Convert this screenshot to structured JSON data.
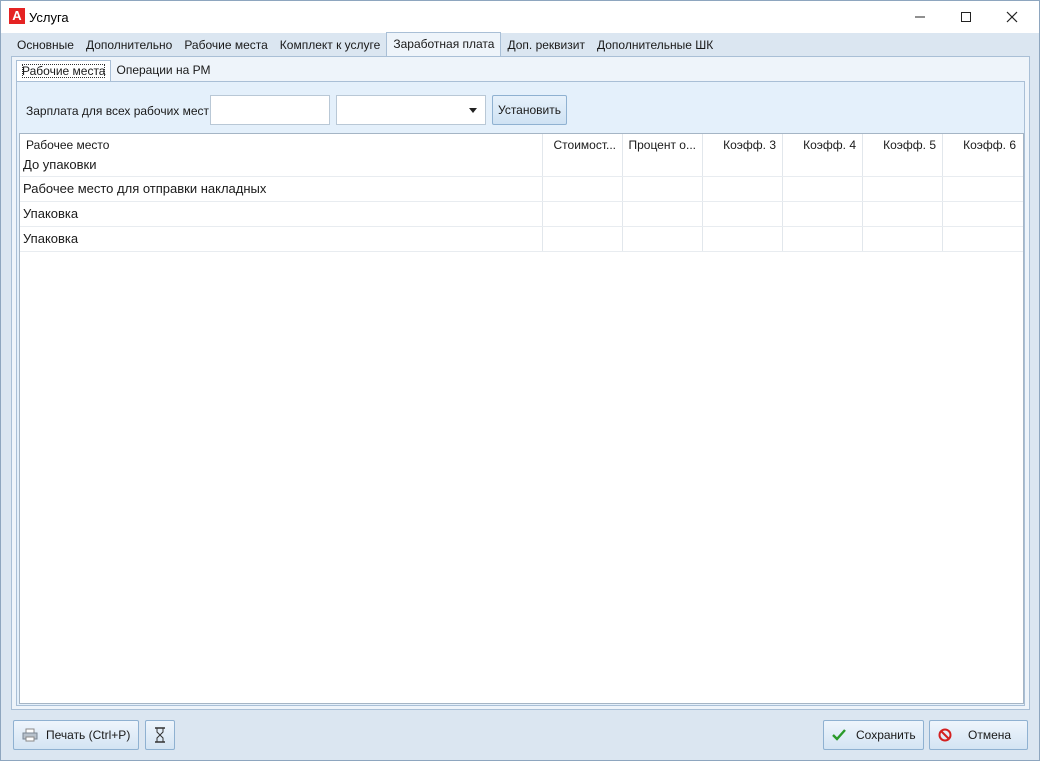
{
  "window": {
    "title": "Услуга",
    "app_icon_letter": "A"
  },
  "tabs": [
    {
      "label": "Основные"
    },
    {
      "label": "Дополнительно"
    },
    {
      "label": "Рабочие места"
    },
    {
      "label": "Комплект к услуге"
    },
    {
      "label": "Заработная плата",
      "active": true
    },
    {
      "label": "Доп. реквизит"
    },
    {
      "label": "Дополнительные ШК"
    }
  ],
  "subtabs": [
    {
      "label": "Рабочие места",
      "active": true
    },
    {
      "label": "Операции на РМ"
    }
  ],
  "salary": {
    "label": "Зарплата для всех рабочих мест",
    "amount_value": "",
    "type_value": "",
    "set_button": "Установить"
  },
  "grid": {
    "columns": [
      "Рабочее место",
      "Стоимост...",
      "Процент о...",
      "Коэфф. 3",
      "Коэфф. 4",
      "Коэфф. 5",
      "Коэфф. 6"
    ],
    "rows": [
      {
        "name": "До упаковки"
      },
      {
        "name": "Рабочее место для отправки накладных"
      },
      {
        "name": "Упаковка"
      },
      {
        "name": "Упаковка"
      }
    ]
  },
  "footer": {
    "print_label": "Печать (Ctrl+P)",
    "save_label": "Сохранить",
    "cancel_label": "Отмена"
  },
  "colors": {
    "accent_red": "#e52323",
    "save_check": "#2a9a2a",
    "cancel_icon": "#d42020"
  }
}
